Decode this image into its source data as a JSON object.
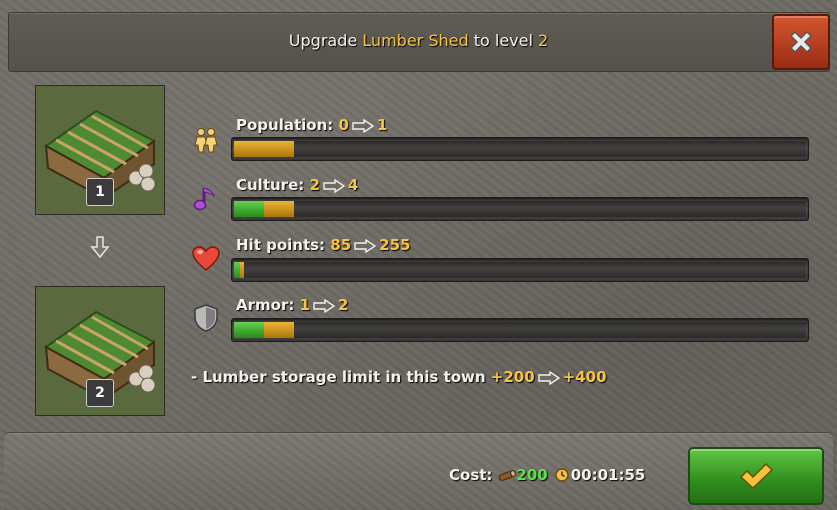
{
  "header": {
    "title_prefix": "Upgrade",
    "building_name": "Lumber Shed",
    "title_mid": "to level",
    "target_level": "2"
  },
  "buildings": [
    {
      "level_badge": "1"
    },
    {
      "level_badge": "2"
    }
  ],
  "stats": [
    {
      "icon": "population-icon",
      "label": "Population:",
      "from": "0",
      "to": "1",
      "current_fraction": 0.0,
      "new_fraction": 0.105
    },
    {
      "icon": "culture-icon",
      "label": "Culture:",
      "from": "2",
      "to": "4",
      "current_fraction": 0.053,
      "new_fraction": 0.105
    },
    {
      "icon": "heart-icon",
      "label": "Hit points:",
      "from": "85",
      "to": "255",
      "current_fraction": 0.01,
      "new_fraction": 0.018
    },
    {
      "icon": "shield-icon",
      "label": "Armor:",
      "from": "1",
      "to": "2",
      "current_fraction": 0.053,
      "new_fraction": 0.105
    }
  ],
  "extra_effect": {
    "text": "- Lumber storage limit in this town",
    "from": "+200",
    "to": "+400"
  },
  "footer": {
    "cost_label": "Cost:",
    "lumber_cost": "200",
    "build_time": "00:01:55"
  },
  "colors": {
    "highlight": "#f6c342",
    "bar_gold": "#d49e27",
    "bar_green": "#46b234",
    "cost_green": "#5fe04a"
  }
}
